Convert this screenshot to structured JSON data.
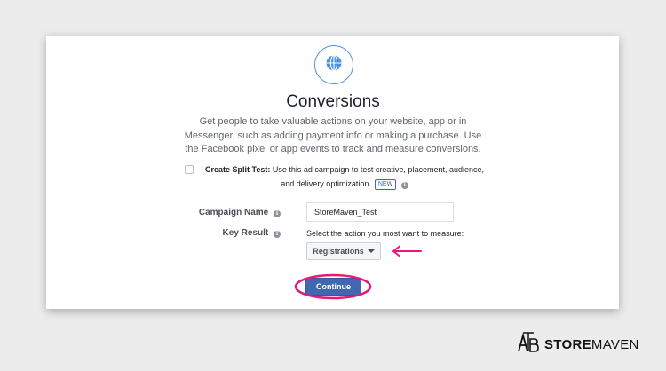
{
  "dialog": {
    "icon": "globe-icon",
    "title": "Conversions",
    "description": "Get people to take valuable actions on your website, app or in Messenger, such as adding payment info or making a purchase. Use the Facebook pixel or app events to track and measure conversions."
  },
  "split_test": {
    "checked": false,
    "label": "Create Split Test:",
    "text": "Use this ad campaign to test creative, placement, audience, and delivery optimization",
    "badge": "NEW"
  },
  "form": {
    "campaign_name_label": "Campaign Name",
    "campaign_name_value": "StoreMaven_Test",
    "key_result_label": "Key Result",
    "key_result_hint": "Select the action you most want to measure:",
    "key_result_selected": "Registrations"
  },
  "continue_label": "Continue",
  "annotation_color": "#e6197a",
  "accent_color": "#4267b2",
  "brand": {
    "logo_icon": "storemaven-ab-icon",
    "name_bold": "STORE",
    "name_light": "MAVEN"
  }
}
